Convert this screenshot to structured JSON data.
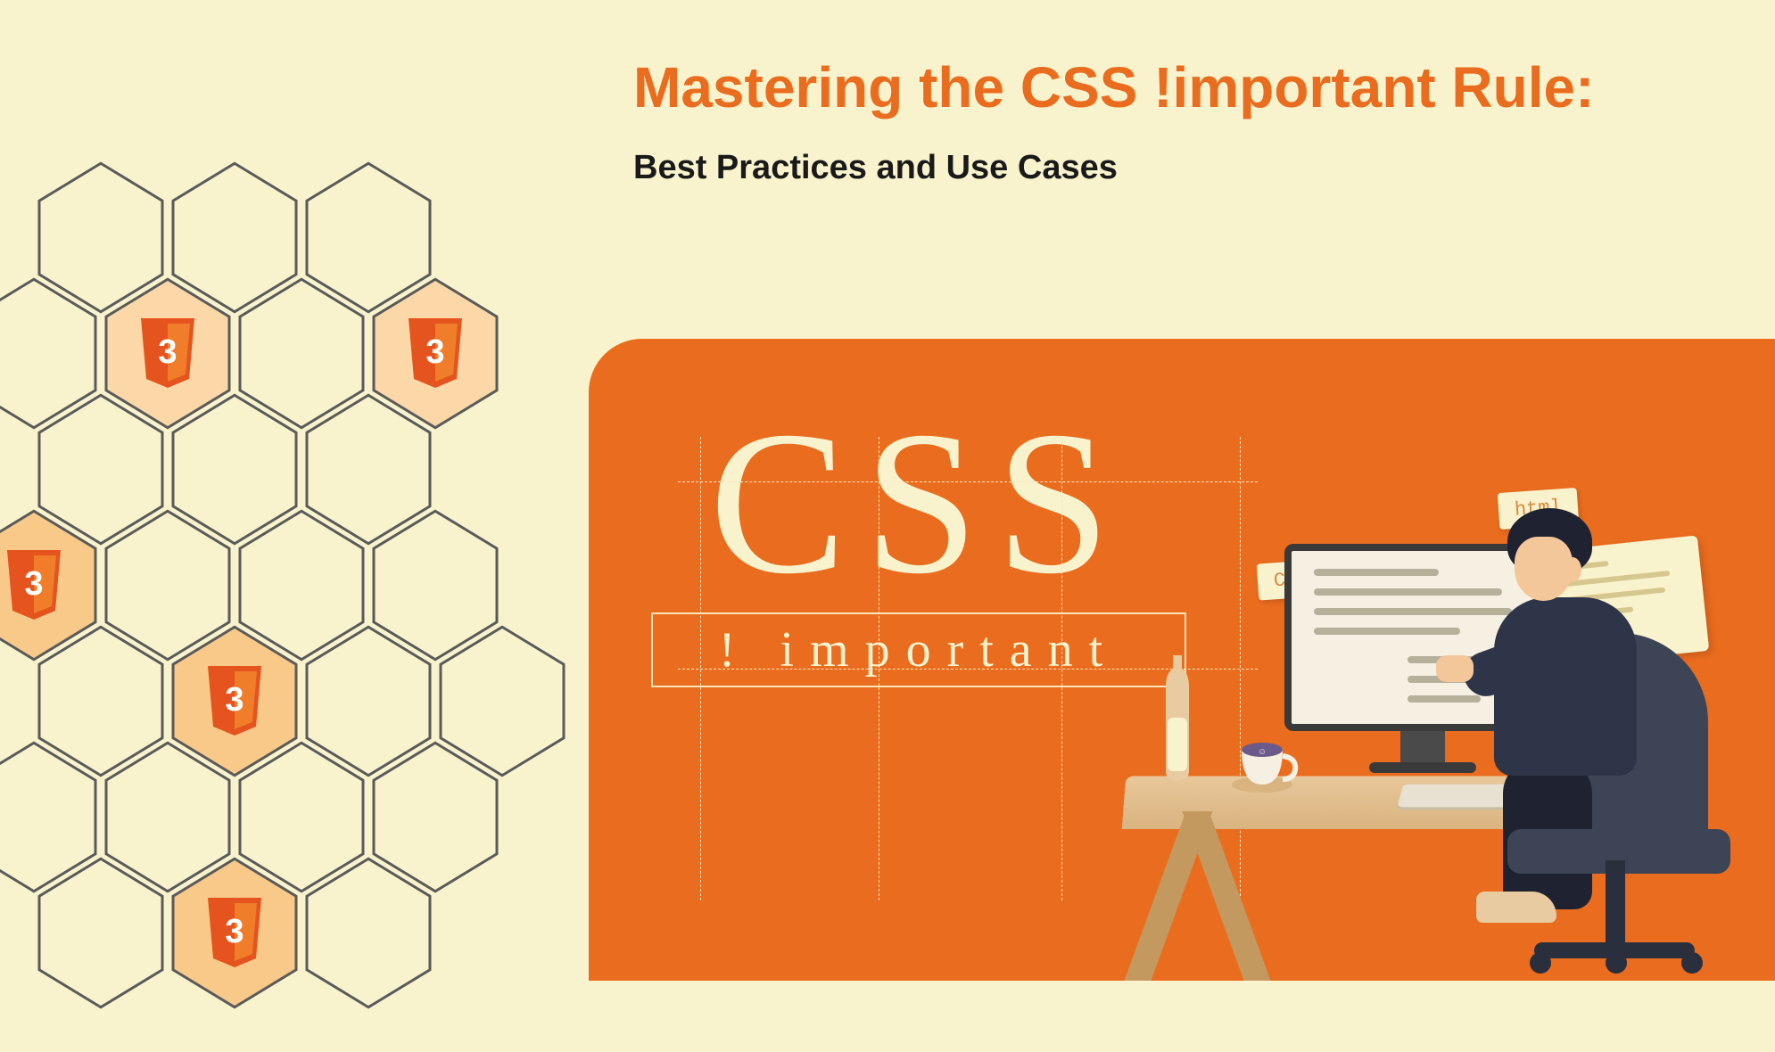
{
  "heading": {
    "title": "Mastering the CSS !important Rule:",
    "subtitle": "Best Practices and Use Cases"
  },
  "graphic": {
    "css_large": "CSS",
    "css_small": "! important",
    "note_css": "Css",
    "note_html": "html"
  },
  "icons": {
    "css3_label": "3"
  },
  "colors": {
    "accent": "#ea6c1e",
    "bg": "#f9f3cd",
    "dark": "#1a1a1a"
  }
}
